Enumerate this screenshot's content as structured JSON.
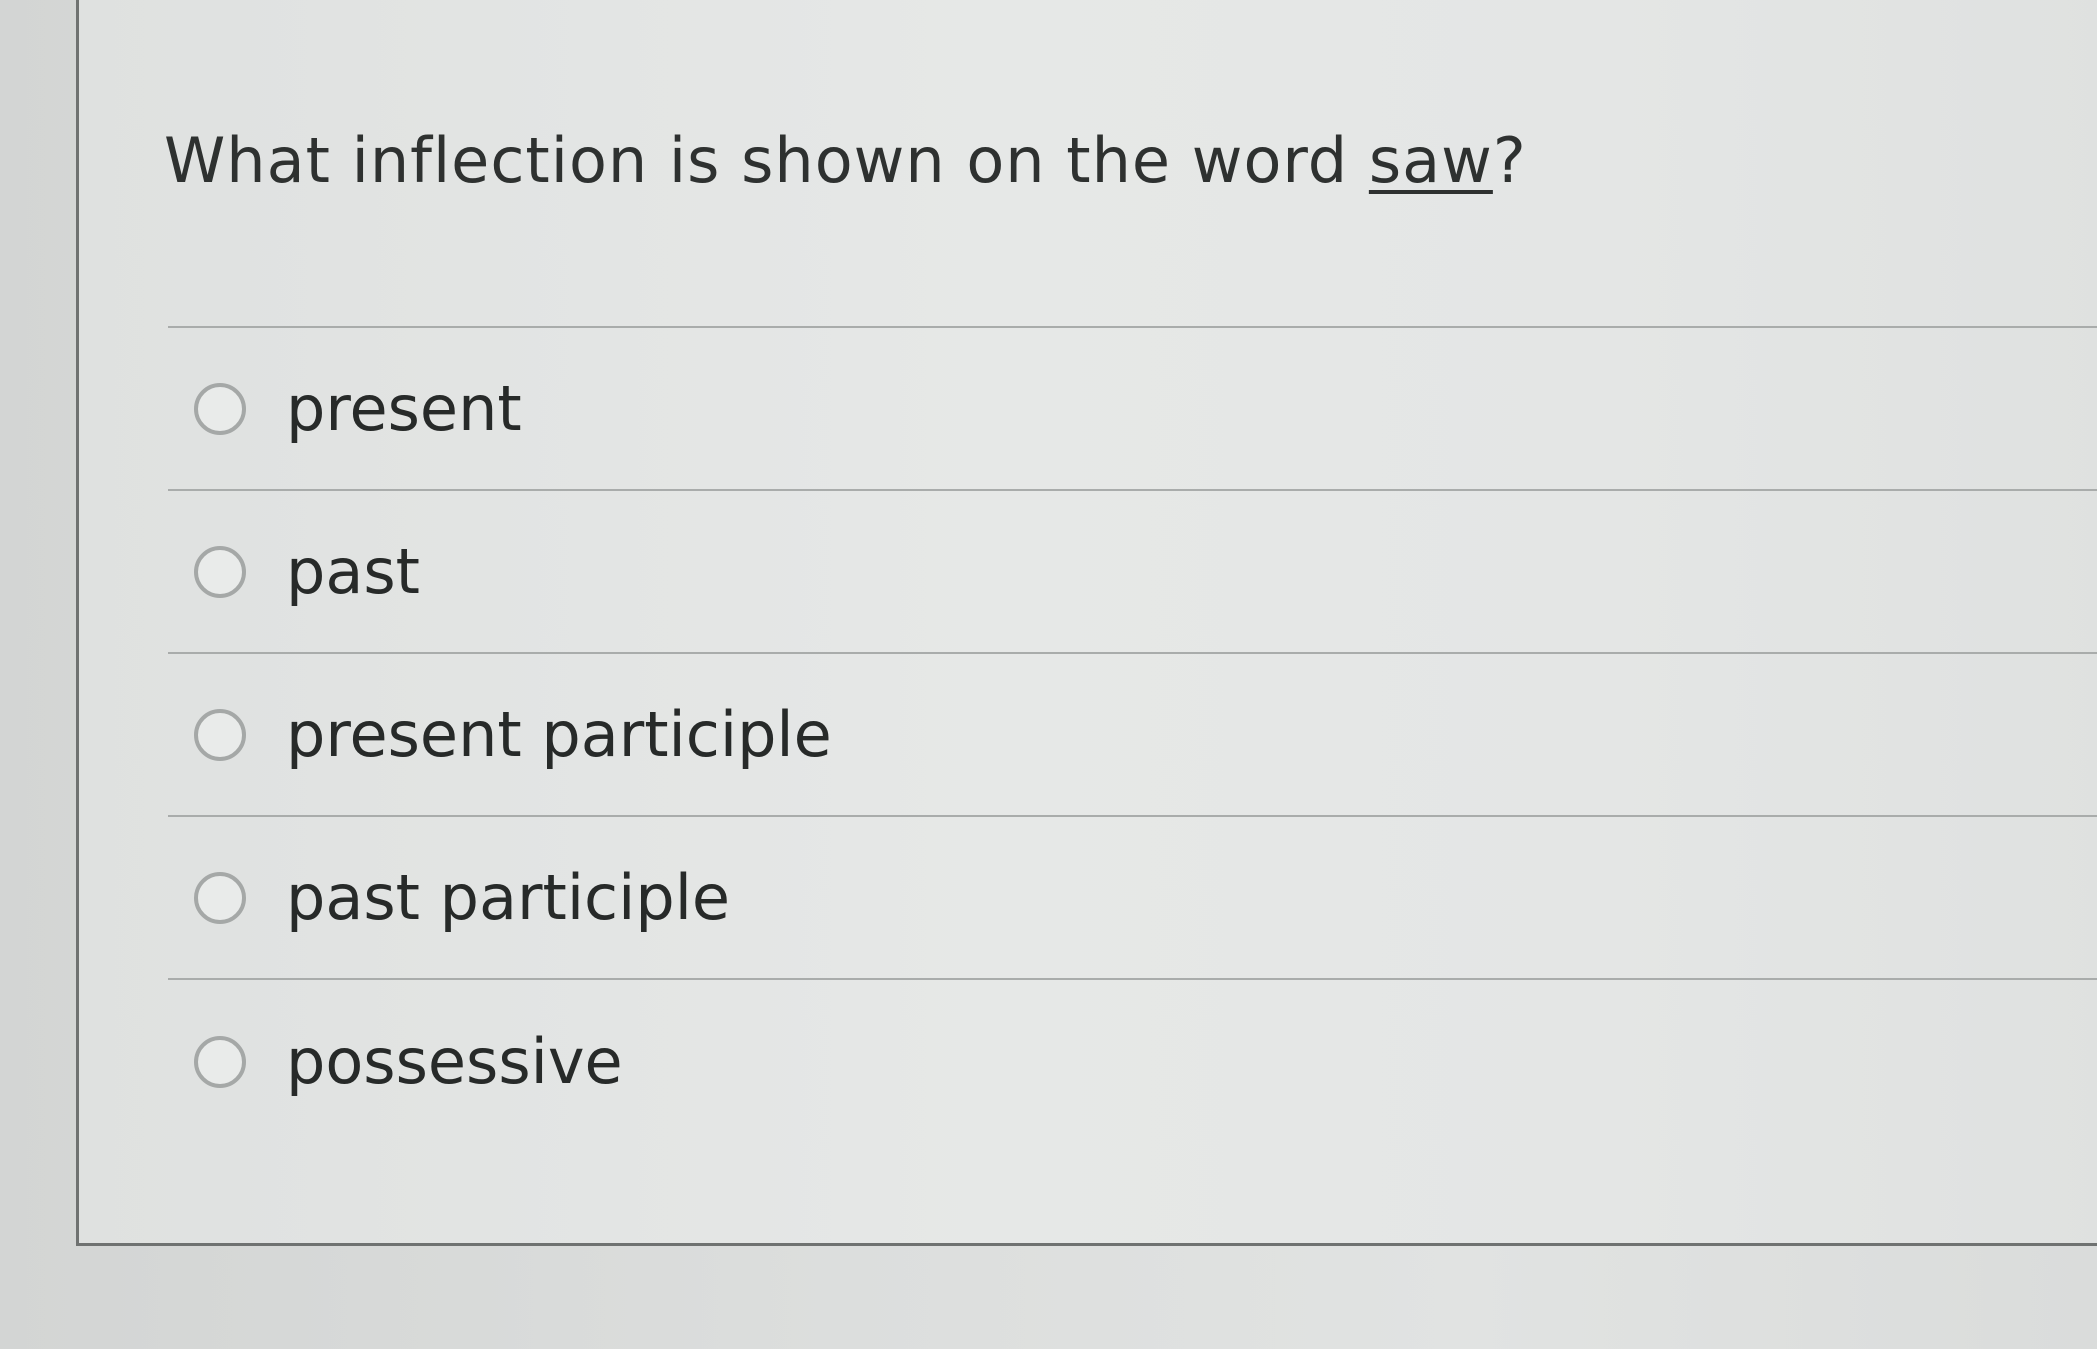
{
  "question": {
    "prefix": "What inflection is shown on the word ",
    "word": "saw",
    "suffix": "?"
  },
  "options": [
    {
      "label": "present",
      "selected": false
    },
    {
      "label": "past",
      "selected": false
    },
    {
      "label": "present participle",
      "selected": false
    },
    {
      "label": "past participle",
      "selected": false
    },
    {
      "label": "possessive",
      "selected": false
    }
  ]
}
